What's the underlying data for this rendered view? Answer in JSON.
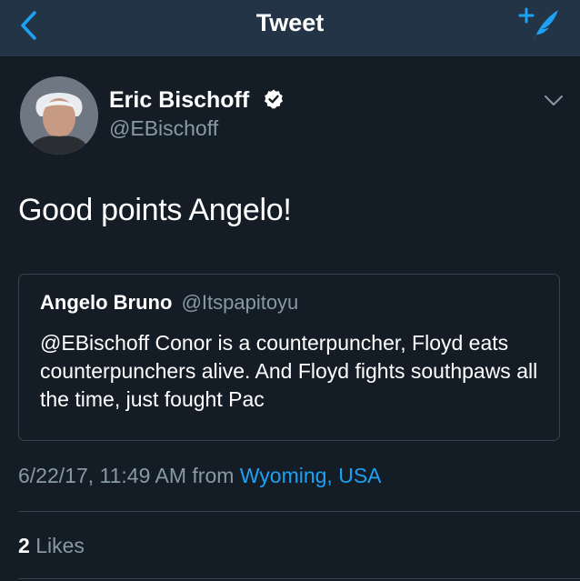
{
  "navbar": {
    "title": "Tweet",
    "back_icon": "chevron-left-icon",
    "compose_icon": "compose-tweet-icon",
    "accent": "#1da1f2"
  },
  "tweet": {
    "author": {
      "name": "Eric Bischoff",
      "handle": "@EBischoff",
      "verified": true
    },
    "text": "Good points Angelo!",
    "quoted": {
      "name": "Angelo Bruno",
      "handle": "@Itspapitoyu",
      "text": "@EBischoff Conor is a counterpuncher, Floyd eats counterpunchers alive. And Floyd fights southpaws all the time, just fought Pac"
    },
    "timestamp": "6/22/17, 11:49 AM",
    "from_label": "from",
    "location": "Wyoming, USA",
    "likes": {
      "count": "2",
      "label": "Likes"
    }
  },
  "colors": {
    "background": "#141d26",
    "navbar": "#243447",
    "secondary_text": "#8899a6",
    "link": "#1da1f2",
    "border": "#38444d"
  }
}
